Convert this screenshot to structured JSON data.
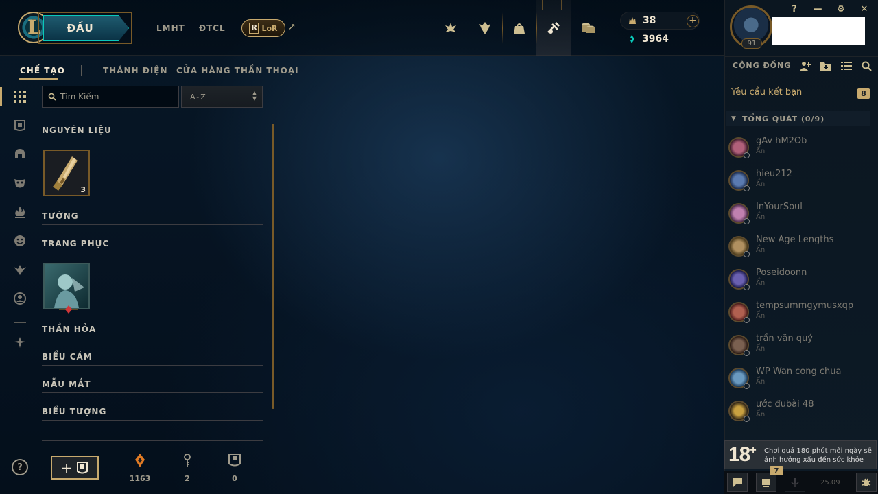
{
  "topbar": {
    "play_label": "ĐẤU",
    "nav_links": [
      "LMHT",
      "ĐTCL"
    ],
    "lor_label": "LoR",
    "lor_mark": "R",
    "external_arrow": "↗",
    "nav_icons": [
      "home-icon",
      "profile-crest-icon",
      "collection-icon",
      "loot-icon",
      "store-icon"
    ],
    "rp": "38",
    "be": "3964",
    "rp_add": "+"
  },
  "window_controls": [
    "?",
    "—",
    "⚙",
    "✕"
  ],
  "subnav": {
    "items": [
      "CHẾ TẠO",
      "THÁNH ĐIỆN",
      "CỬA HÀNG THẦN THOẠI"
    ]
  },
  "left_rail": [
    "grid-icon",
    "chest-icon",
    "helmet-icon",
    "mask-icon",
    "flame-icon",
    "emote-icon",
    "ward-icon",
    "icon-icon",
    "eternals-icon"
  ],
  "search": {
    "placeholder": "Tìm Kiếm",
    "sort_value": "A-Z"
  },
  "loot": {
    "sections": [
      "NGUYÊN LIỆU",
      "TƯỚNG",
      "TRANG PHỤC",
      "THẦN HỎA",
      "BIỂU CẢM",
      "MẪU MẮT",
      "BIỂU TƯỢNG"
    ],
    "key_fragment_count": "3"
  },
  "footer": {
    "help": "?",
    "chest_plus": "+",
    "essence_orange": "1163",
    "keys": "2",
    "chests": "0"
  },
  "profile": {
    "level": "91"
  },
  "social": {
    "title": "CỘNG ĐỒNG",
    "friend_requests_label": "Yêu cầu kết bạn",
    "friend_requests_count": "8",
    "group_label": "TỔNG QUÁT (0/9)",
    "friends": [
      {
        "name": "gAv hM2Ob",
        "status": "Ẩn",
        "color": "#7a3a5a"
      },
      {
        "name": "hieu212",
        "status": "Ẩn",
        "color": "#2a4a7a"
      },
      {
        "name": "InYourSoul",
        "status": "Ẩn",
        "color": "#8a4a7a"
      },
      {
        "name": "New Age Lengths",
        "status": "Ẩn",
        "color": "#8a6a3a"
      },
      {
        "name": "Poseidoonn",
        "status": "Ẩn",
        "color": "#3a3a7a"
      },
      {
        "name": "tempsummgymusxqp",
        "status": "Ẩn",
        "color": "#7a3a2a"
      },
      {
        "name": "trần văn quý",
        "status": "Ẩn",
        "color": "#4a3a2a"
      },
      {
        "name": "WP Wan cong chua",
        "status": "Ẩn",
        "color": "#3a5a7a"
      },
      {
        "name": "ước đubài 48",
        "status": "Ẩn",
        "color": "#5a4a2a"
      }
    ],
    "age_rating": "18",
    "age_plus": "+",
    "age_warning": "Chơi quá 180 phút mỗi ngày sẽ ảnh hưởng xấu đến sức khỏe",
    "notifications_count": "7",
    "version": "25.09"
  }
}
